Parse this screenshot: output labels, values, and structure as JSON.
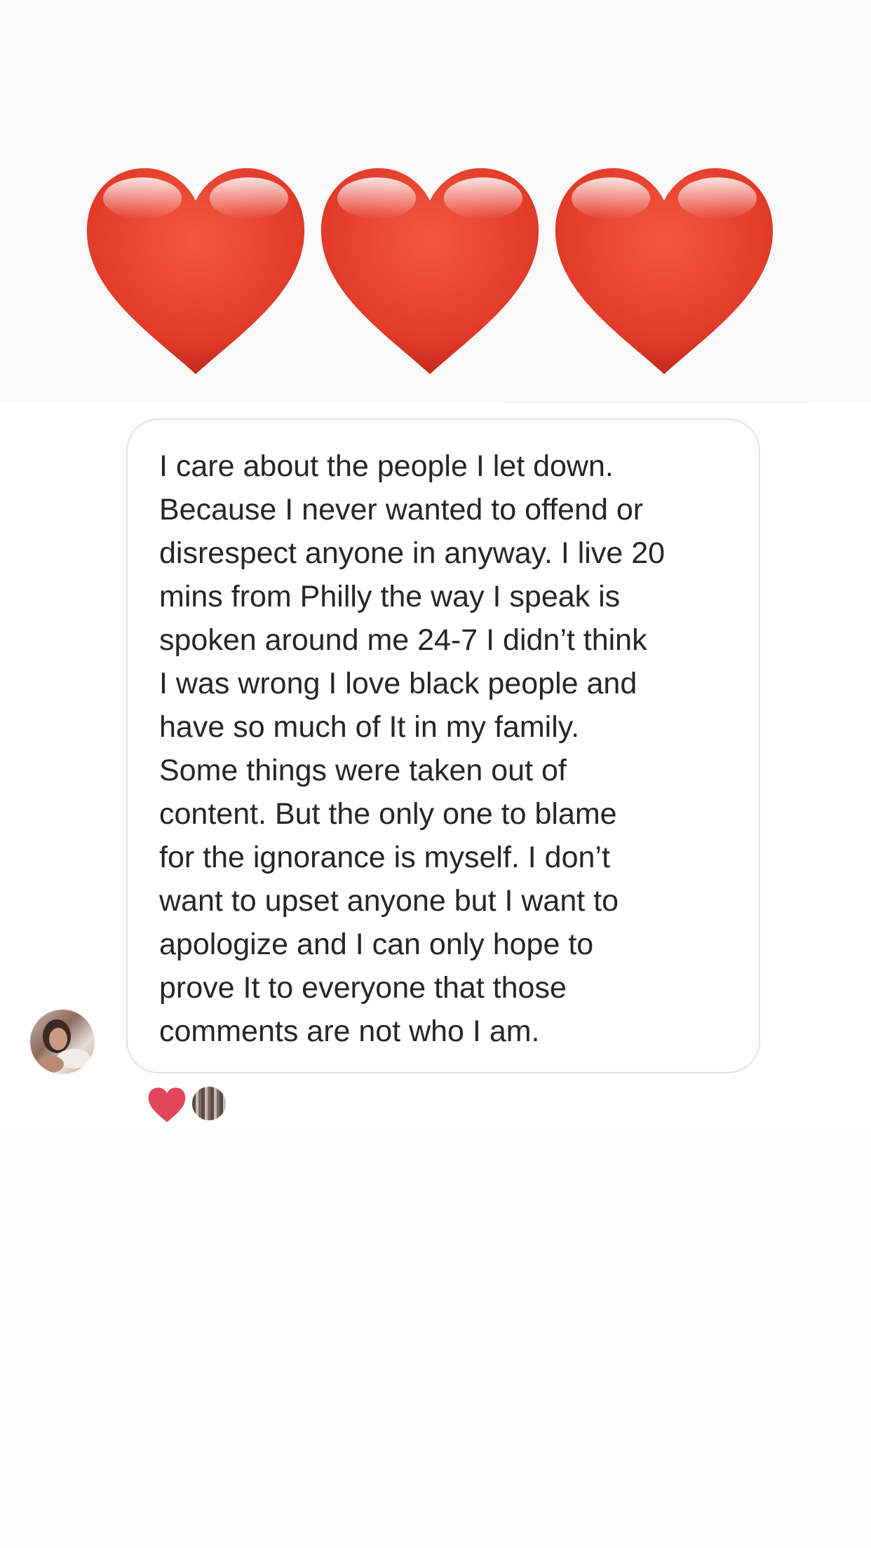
{
  "story": {
    "sticker": {
      "icon": "red-heart-emoji",
      "count": 3,
      "color": "#e8412e"
    },
    "message": {
      "text": "I care about the people I let down.\nBecause I never wanted to offend or\ndisrespect anyone in anyway. I live 20\nmins from Philly the way I speak is\nspoken around me 24-7 I didn’t think\nI was wrong I love black people and\nhave so much of It in my family.\nSome things were taken out of\ncontent. But the only one to blame\nfor the ignorance is myself. I don’t\nwant to upset anyone but I want to\napologize and I can only hope to\nprove It to everyone that those\ncomments are not who I am.",
      "sender_avatar_icon": "user-avatar"
    },
    "reactions": [
      {
        "icon": "heart-reaction-icon",
        "color": "#e0455a"
      },
      {
        "icon": "reactor-avatar"
      }
    ]
  }
}
